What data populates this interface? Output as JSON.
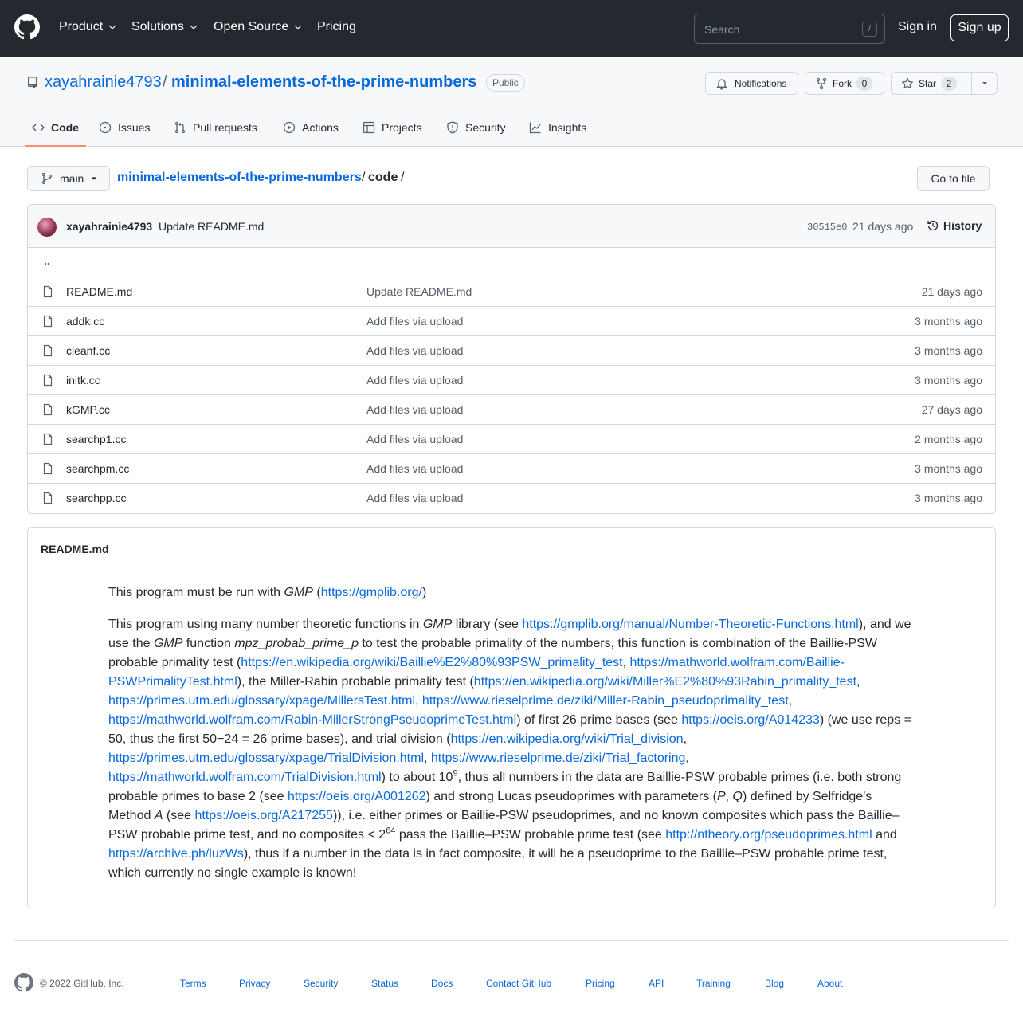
{
  "header": {
    "nav": [
      "Product",
      "Solutions",
      "Open Source",
      "Pricing"
    ],
    "search_placeholder": "Search",
    "search_key": "/",
    "signin": "Sign in",
    "signup": "Sign up"
  },
  "repo": {
    "owner": "xayahrainie4793",
    "separator": "/",
    "name": "minimal-elements-of-the-prime-numbers",
    "visibility": "Public",
    "notifications_label": "Notifications",
    "fork_label": "Fork",
    "fork_count": "0",
    "star_label": "Star",
    "star_count": "2"
  },
  "tabs": [
    "Code",
    "Issues",
    "Pull requests",
    "Actions",
    "Projects",
    "Security",
    "Insights"
  ],
  "branch": {
    "name": "main",
    "crumb_repo": "minimal-elements-of-the-prime-numbers",
    "crumb_sep": "/",
    "crumb_dir": "code",
    "goto_file": "Go to file"
  },
  "commit": {
    "author": "xayahrainie4793",
    "message": "Update README.md",
    "sha": "30515e0",
    "ago": "21 days ago",
    "history": "History"
  },
  "parent_dir": "..",
  "files": [
    {
      "name": "README.md",
      "message": "Update README.md",
      "age": "21 days ago"
    },
    {
      "name": "addk.cc",
      "message": "Add files via upload",
      "age": "3 months ago"
    },
    {
      "name": "cleanf.cc",
      "message": "Add files via upload",
      "age": "3 months ago"
    },
    {
      "name": "initk.cc",
      "message": "Add files via upload",
      "age": "3 months ago"
    },
    {
      "name": "kGMP.cc",
      "message": "Add files via upload",
      "age": "27 days ago"
    },
    {
      "name": "searchp1.cc",
      "message": "Add files via upload",
      "age": "2 months ago"
    },
    {
      "name": "searchpm.cc",
      "message": "Add files via upload",
      "age": "3 months ago"
    },
    {
      "name": "searchpp.cc",
      "message": "Add files via upload",
      "age": "3 months ago"
    }
  ],
  "readme": {
    "title": "README.md",
    "p1": {
      "t1": "This program must be run with ",
      "gmp": "GMP",
      "t2": " (",
      "link": "https://gmplib.org/",
      "t3": ")"
    },
    "p2": {
      "a": "This program using many number theoretic functions in ",
      "gmp1": "GMP",
      "b": " library (see ",
      "l1": "https://gmplib.org/manual/Number-Theoretic-Functions.html",
      "c": "), and we use the ",
      "gmp2": "GMP",
      "d": " function ",
      "fn": "mpz_probab_prime_p",
      "e": " to test the probable primality of the numbers, this function is combination of the Baillie-PSW probable primality test (",
      "l2": "https://en.wikipedia.org/wiki/Baillie%E2%80%93PSW_primality_test",
      "f": ", ",
      "l3": "https://mathworld.wolfram.com/Baillie-PSWPrimalityTest.html",
      "g": "), the Miller-Rabin probable primality test (",
      "l4": "https://en.wikipedia.org/wiki/Miller%E2%80%93Rabin_primality_test",
      "h": ",",
      "l5": "https://primes.utm.edu/glossary/xpage/MillersTest.html",
      "i": ", ",
      "l6": "https://www.rieselprime.de/ziki/Miller-Rabin_pseudoprimality_test",
      "j": ",",
      "l7": "https://mathworld.wolfram.com/Rabin-MillerStrongPseudoprimeTest.html",
      "k": ") of first 26 prime bases (see ",
      "l8": "https://oeis.org/A014233",
      "l": ") (we use reps = 50, thus the first 50−24 = 26 prime bases), and trial division (",
      "l9": "https://en.wikipedia.org/wiki/Trial_division",
      "m": ",",
      "l10": "https://primes.utm.edu/glossary/xpage/TrialDivision.html",
      "n": ", ",
      "l11": "https://www.rieselprime.de/ziki/Trial_factoring",
      "o": ",",
      "l12": "https://mathworld.wolfram.com/TrialDivision.html",
      "p": ") to about 10",
      "exp9": "9",
      "q": ", thus all numbers in the data are Baillie-PSW probable primes (i.e. both strong probable primes to base 2 (see ",
      "l13": "https://oeis.org/A001262",
      "r": ") and strong Lucas pseudoprimes with parameters (",
      "P": "P",
      "s": ", ",
      "Q": "Q",
      "t": ") defined by Selfridge's Method ",
      "A": "A",
      "u": " (see ",
      "l14": "https://oeis.org/A217255",
      "v": ")), i.e. either primes or Baillie-PSW pseudoprimes, and no known composites which pass the Baillie–PSW probable prime test, and no composites < 2",
      "exp64": "64",
      "w": " pass the Baillie–PSW probable prime test (see ",
      "l15": "http://ntheory.org/pseudoprimes.html",
      "x": " and ",
      "l16": "https://archive.ph/luzWs",
      "y": "), thus if a number in the data is in fact composite, it will be a pseudoprime to the Baillie–PSW probable prime test, which currently no single example is known!"
    }
  },
  "footer": {
    "copyright": "© 2022 GitHub, Inc.",
    "links": [
      "Terms",
      "Privacy",
      "Security",
      "Status",
      "Docs",
      "Contact GitHub",
      "Pricing",
      "API",
      "Training",
      "Blog",
      "About"
    ]
  }
}
